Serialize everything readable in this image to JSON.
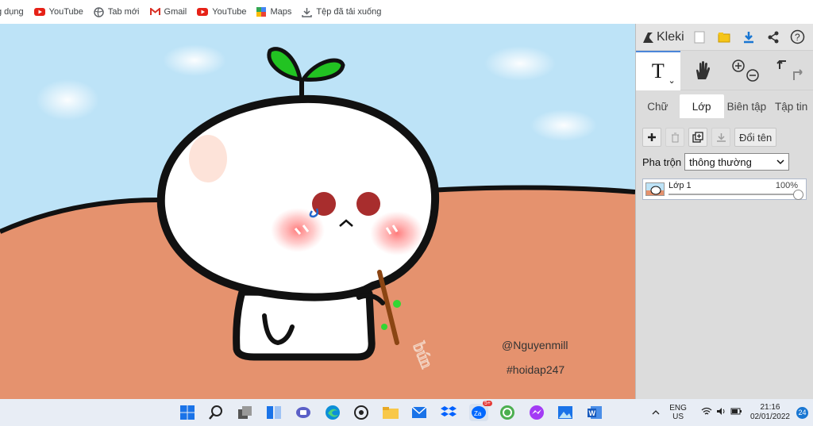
{
  "bookmarks": [
    {
      "label": "g dụng",
      "icon": "grid-icon"
    },
    {
      "label": "YouTube",
      "icon": "youtube-icon"
    },
    {
      "label": "Tab mới",
      "icon": "globe-icon"
    },
    {
      "label": "Gmail",
      "icon": "gmail-icon"
    },
    {
      "label": "YouTube",
      "icon": "youtube-icon"
    },
    {
      "label": "Maps",
      "icon": "maps-icon"
    },
    {
      "label": "Tệp đã tải xuống",
      "icon": "download-icon"
    }
  ],
  "canvas": {
    "watermark_user": "@Nguyenmill",
    "watermark_tag": "#hoidap247",
    "handwriting": "bún"
  },
  "panel": {
    "logo": "Kleki",
    "tools": {
      "text_glyph": "T",
      "text_caret": "⌄"
    },
    "tabs": [
      "Chữ",
      "Lớp",
      "Biên tập",
      "Tập tin"
    ],
    "active_tab": "Lớp",
    "layer_buttons": {
      "rename": "Đổi tên"
    },
    "blend_label": "Pha trộn",
    "blend_value": "thông thường",
    "layers": [
      {
        "name": "Lớp 1",
        "opacity": "100%"
      }
    ]
  },
  "taskbar": {
    "zalo_badge": "5+",
    "lang_line1": "ENG",
    "lang_line2": "US",
    "time": "21:16",
    "date": "02/01/2022",
    "notifications": "24"
  },
  "colors": {
    "sky": "#bde3f7",
    "ground": "#e5926e",
    "panel": "#dcdcdc",
    "accent": "#4a86d9"
  }
}
